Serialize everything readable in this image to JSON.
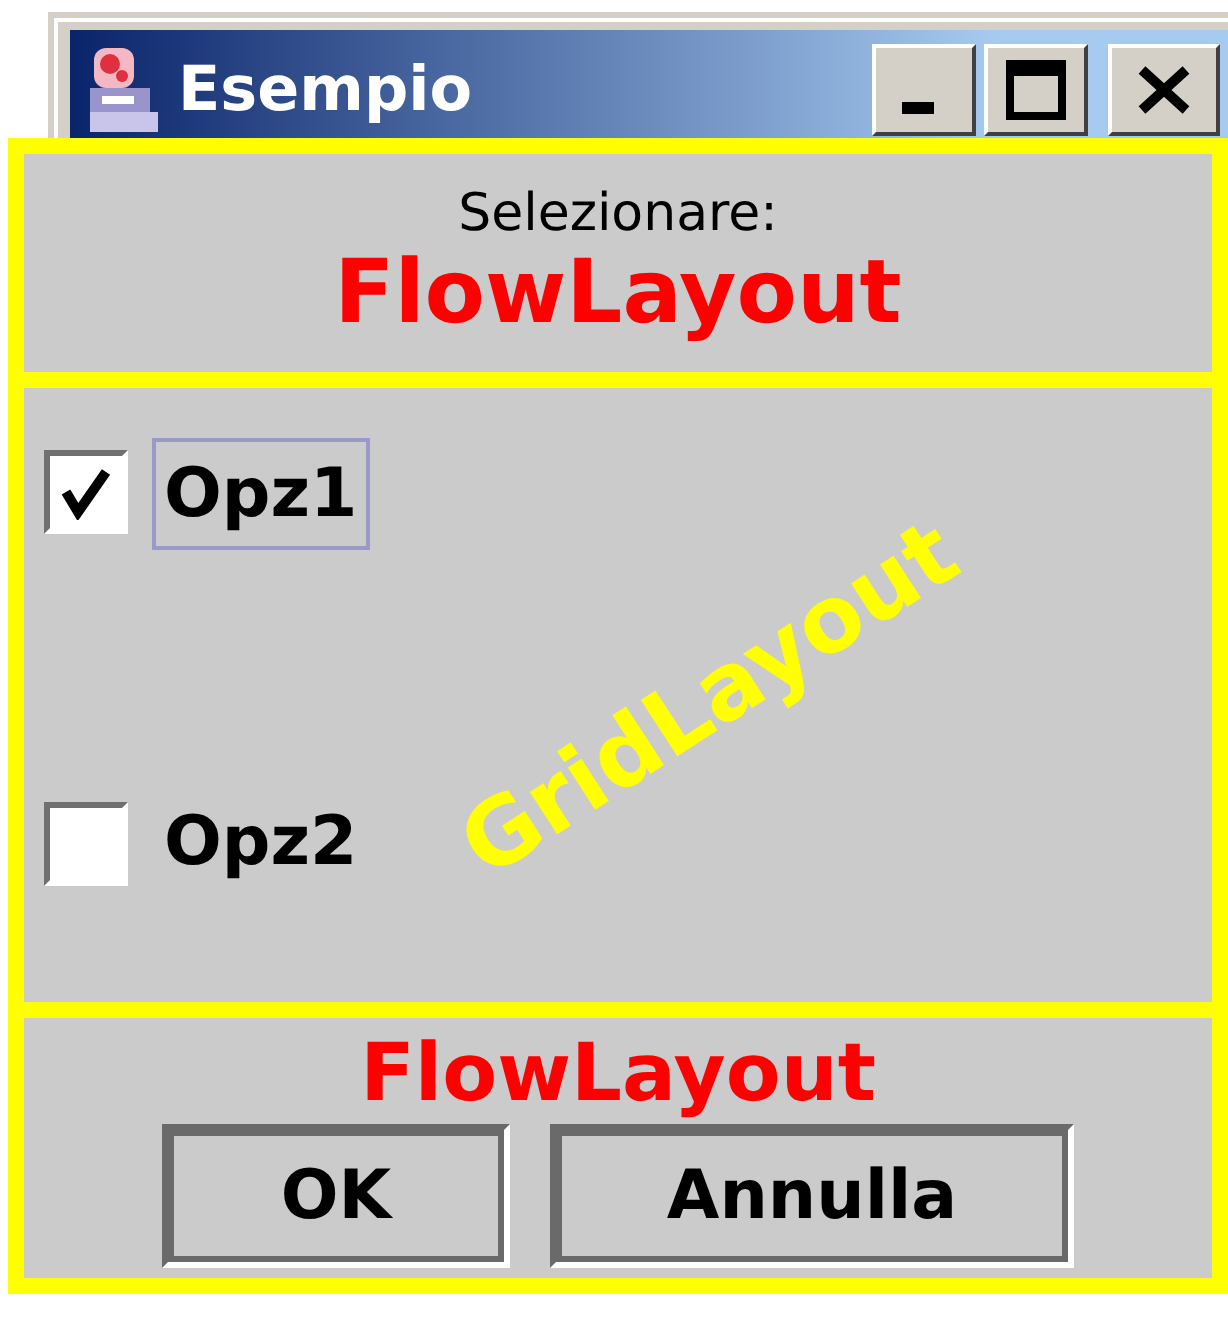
{
  "window": {
    "title": "Esempio"
  },
  "header": {
    "label": "Selezionare:",
    "annotation": {
      "text": "FlowLayout",
      "color": "#ff0000"
    }
  },
  "options": {
    "items": [
      {
        "label": "Opz1",
        "checked": true,
        "focused": true
      },
      {
        "label": "Opz2",
        "checked": false,
        "focused": false
      }
    ],
    "annotation": {
      "text": "GridLayout",
      "color": "#ffff00"
    }
  },
  "footer": {
    "buttons": [
      "OK",
      "Annulla"
    ],
    "annotation": {
      "text": "FlowLayout",
      "color": "#ff0000"
    }
  }
}
